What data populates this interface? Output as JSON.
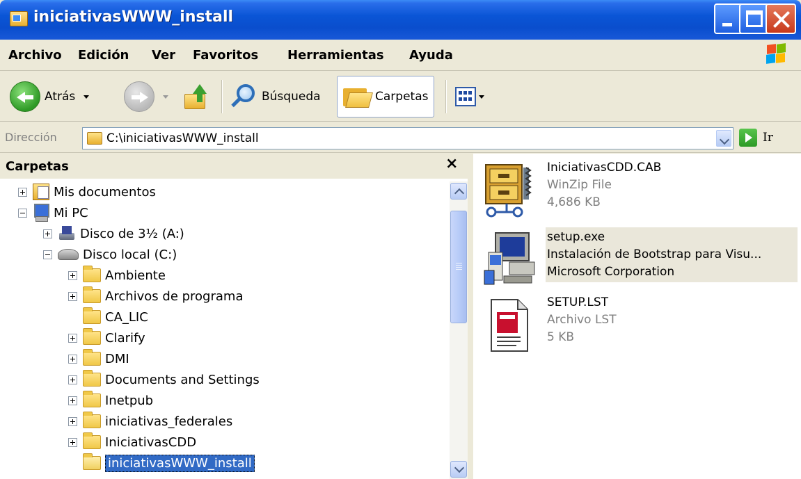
{
  "window": {
    "title": "iniciativasWWW_install"
  },
  "menu": [
    "Archivo",
    "Edición",
    "Ver",
    "Favoritos",
    "Herramientas",
    "Ayuda"
  ],
  "toolbar": {
    "back_label": "Atrás",
    "search_label": "Búsqueda",
    "folders_label": "Carpetas"
  },
  "address": {
    "label": "Dirección",
    "path": "C:\\iniciativasWWW_install",
    "go_label": "Ir"
  },
  "folder_pane": {
    "title": "Carpetas",
    "close_glyph": "×",
    "tree": [
      {
        "label": "Mis documentos",
        "icon": "my-documents-icon",
        "expander": "plus",
        "level": 0
      },
      {
        "label": "Mi PC",
        "icon": "my-computer-icon",
        "expander": "minus",
        "level": 0
      },
      {
        "label": "Disco de 3½ (A:)",
        "icon": "floppy-drive-icon",
        "expander": "plus",
        "level": 1
      },
      {
        "label": "Disco local (C:)",
        "icon": "hard-drive-icon",
        "expander": "minus",
        "level": 1
      },
      {
        "label": "Ambiente",
        "icon": "folder-icon",
        "expander": "plus",
        "level": 2
      },
      {
        "label": "Archivos de programa",
        "icon": "folder-icon",
        "expander": "plus",
        "level": 2
      },
      {
        "label": "CA_LIC",
        "icon": "folder-icon",
        "expander": "none",
        "level": 2
      },
      {
        "label": "Clarify",
        "icon": "folder-icon",
        "expander": "plus",
        "level": 2
      },
      {
        "label": "DMI",
        "icon": "folder-icon",
        "expander": "plus",
        "level": 2
      },
      {
        "label": "Documents and Settings",
        "icon": "folder-icon",
        "expander": "plus",
        "level": 2
      },
      {
        "label": "Inetpub",
        "icon": "folder-icon",
        "expander": "plus",
        "level": 2
      },
      {
        "label": "iniciativas_federales",
        "icon": "folder-icon",
        "expander": "plus",
        "level": 2
      },
      {
        "label": "IniciativasCDD",
        "icon": "folder-icon",
        "expander": "plus",
        "level": 2
      },
      {
        "label": "iniciativasWWW_install",
        "icon": "open-folder-icon",
        "expander": "none",
        "level": 2,
        "selected": true
      }
    ]
  },
  "files": [
    {
      "name": "IniciativasCDD.CAB",
      "line2": "WinZip File",
      "line3": "4,686 KB",
      "icon": "winzip-file-icon"
    },
    {
      "name": "setup.exe",
      "line2": "Instalación de Bootstrap para Visu...",
      "line3": "Microsoft Corporation",
      "icon": "setup-program-icon",
      "highlighted": true
    },
    {
      "name": "SETUP.LST",
      "line2": "Archivo LST",
      "line3": "5 KB",
      "icon": "lst-file-icon"
    }
  ],
  "colors": {
    "titlebar": "#0A55D6",
    "selection": "#316AC5",
    "chrome": "#ECE9D8"
  }
}
